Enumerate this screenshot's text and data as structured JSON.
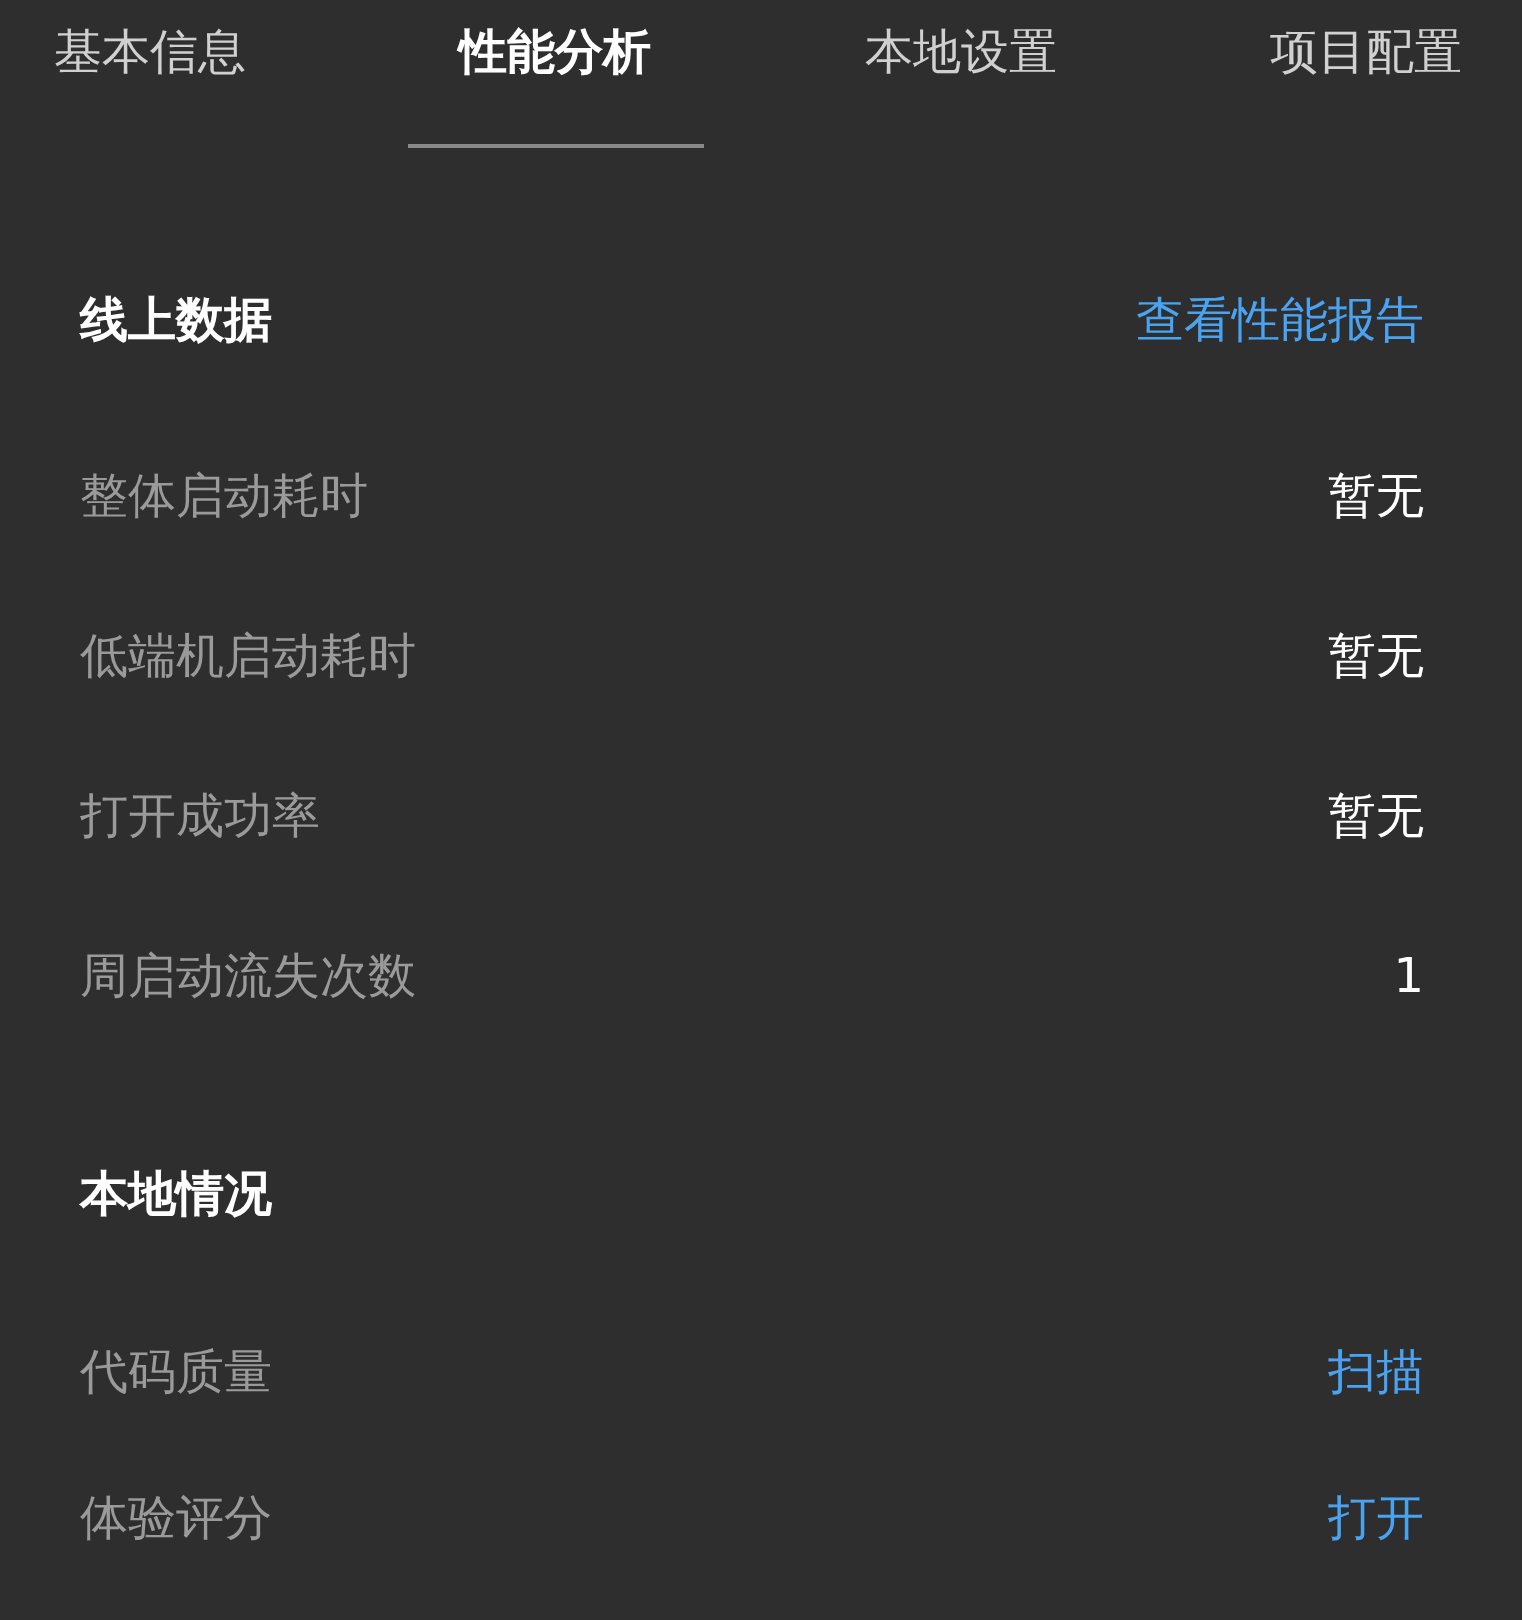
{
  "tabs": [
    {
      "label": "基本信息",
      "selected": false
    },
    {
      "label": "性能分析",
      "selected": true
    },
    {
      "label": "本地设置",
      "selected": false
    },
    {
      "label": "项目配置",
      "selected": false
    }
  ],
  "sections": [
    {
      "title": "线上数据",
      "action": "查看性能报告",
      "rows": [
        {
          "label": "整体启动耗时",
          "value": "暂无",
          "kind": "text"
        },
        {
          "label": "低端机启动耗时",
          "value": "暂无",
          "kind": "text"
        },
        {
          "label": "打开成功率",
          "value": "暂无",
          "kind": "text"
        },
        {
          "label": "周启动流失次数",
          "value": "1",
          "kind": "text"
        }
      ]
    },
    {
      "title": "本地情况",
      "rows": [
        {
          "label": "代码质量",
          "value": "扫描",
          "kind": "link"
        },
        {
          "label": "体验评分",
          "value": "打开",
          "kind": "link"
        }
      ]
    }
  ]
}
